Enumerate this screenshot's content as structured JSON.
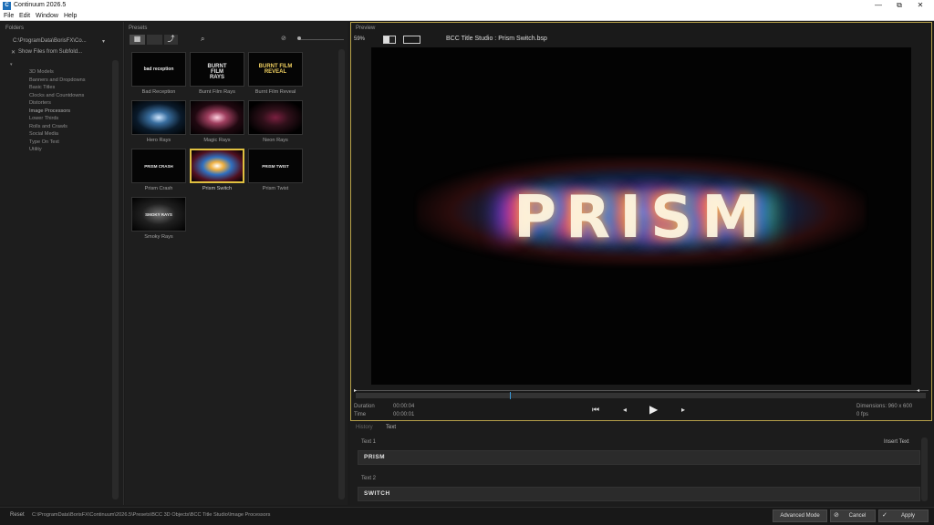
{
  "app": {
    "title": "Continuum 2026.5",
    "logo": "C"
  },
  "menu": [
    "File",
    "Edit",
    "Window",
    "Help"
  ],
  "window_controls": {
    "minimize": "—",
    "restore": "⧉",
    "close": "✕"
  },
  "folders": {
    "header": "Folders",
    "path": "C:\\ProgramData\\BorisFX\\Co...",
    "show_subfolders": "Show Files from Subfold...",
    "items": [
      "3D Models",
      "Banners and Dropdowns",
      "Basic Titles",
      "Clocks and Countdowns",
      "Distorters",
      "Image Processors",
      "Lower Thirds",
      "Rolls and Crawls",
      "Social Media",
      "Type On Text",
      "Utility"
    ]
  },
  "presets": {
    "header": "Presets",
    "tiles": [
      {
        "label": "Bad Reception",
        "thumb": "bad reception",
        "style": "plain"
      },
      {
        "label": "Burnt Film Rays",
        "thumb": "BURNT FILM RAYS",
        "style": "bold"
      },
      {
        "label": "Burnt Film Reveal",
        "thumb": "BURNT FILM REVEAL",
        "style": "bold"
      },
      {
        "label": "Hero Rays",
        "thumb": "",
        "style": "hero"
      },
      {
        "label": "Magic Rays",
        "thumb": "",
        "style": "magic"
      },
      {
        "label": "Neon Rays",
        "thumb": "",
        "style": "neon"
      },
      {
        "label": "Prism Crash",
        "thumb": "PRISM CRASH",
        "style": "plain"
      },
      {
        "label": "Prism Switch",
        "thumb": "",
        "style": "prism",
        "selected": true
      },
      {
        "label": "Prism Twist",
        "thumb": "PRISM TWIST",
        "style": "plain"
      },
      {
        "label": "Smoky Rays",
        "thumb": "SMOKY RAYS",
        "style": "smoky"
      }
    ]
  },
  "preview": {
    "header": "Preview",
    "zoom": "59%",
    "file_title": "BCC Title Studio : Prism Switch.bsp",
    "render_text": "PRISM",
    "duration_label": "Duration",
    "duration_value": "00:00:04",
    "time_label": "Time",
    "time_value": "00:00:01",
    "dimensions": "Dimensions: 960 x 600",
    "fps": "0 fps",
    "progress": 0.27
  },
  "params": {
    "tabs": [
      "History",
      "Text"
    ],
    "text1_label": "Text 1",
    "insert_text": "Insert Text",
    "text1_value": "PRISM",
    "text2_label": "Text 2",
    "text2_value": "SWITCH"
  },
  "status": {
    "reset": "Reset",
    "path": "C:\\ProgramData\\BorisFX\\Continuum\\2026.5\\Presets\\BCC 3D Objects\\BCC Title Studio\\Image Processors",
    "advanced": "Advanced Mode",
    "cancel": "Cancel",
    "apply": "Apply"
  }
}
